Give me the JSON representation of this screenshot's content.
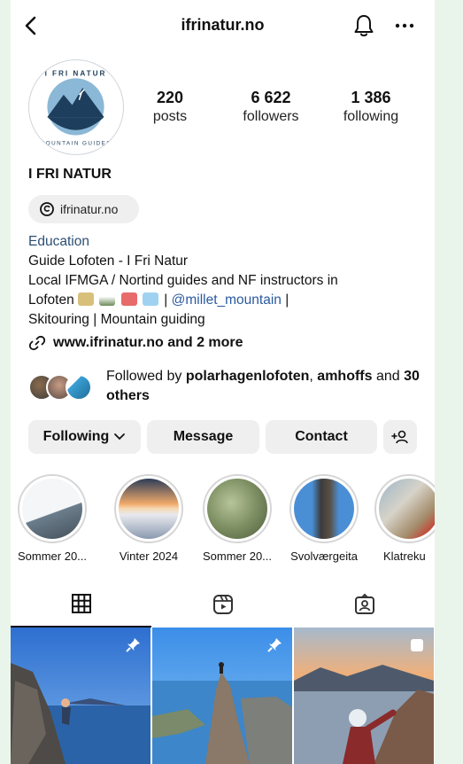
{
  "header": {
    "handle": "ifrinatur.no"
  },
  "icons": {
    "back": "chevron-left-icon",
    "notifications": "bell-icon",
    "more": "more-horizontal-icon"
  },
  "avatar": {
    "logo_text_top": "I FRI NATUR",
    "logo_text_bottom": "MOUNTAIN GUIDES"
  },
  "stats": [
    {
      "value": "220",
      "label": "posts"
    },
    {
      "value": "6 622",
      "label": "followers"
    },
    {
      "value": "1 386",
      "label": "following"
    }
  ],
  "profile": {
    "name": "I FRI NATUR",
    "threads_handle": "ifrinatur.no",
    "category": "Education",
    "bio_line1": "Guide Lofoten - I Fri Natur",
    "bio_line2": "Local IFMGA / Nortind guides and NF instructors in",
    "bio_line3_prefix": "Lofoten",
    "bio_line3_sep": "|",
    "bio_mention": "@millet_mountain",
    "bio_line3_suffix": "|",
    "bio_line4": "Skitouring | Mountain guiding",
    "link": "www.ifrinatur.no and 2 more"
  },
  "followed_by": {
    "prefix": "Followed by",
    "user1": "polarhagenlofoten",
    "comma": ",",
    "user2": "amhoffs",
    "and": "and",
    "others": "30 others"
  },
  "buttons": {
    "following": "Following",
    "message": "Message",
    "contact": "Contact"
  },
  "highlights": [
    {
      "label": "Sommer 20..."
    },
    {
      "label": "Vinter 2024"
    },
    {
      "label": "Sommer 20..."
    },
    {
      "label": "Svolværgeita"
    },
    {
      "label": "Klatreku"
    }
  ],
  "tabs": [
    {
      "name": "posts-grid-icon"
    },
    {
      "name": "reels-icon"
    },
    {
      "name": "tagged-icon"
    }
  ],
  "colors": {
    "accent_link": "#2a5aa0",
    "category": "#2c4f73",
    "button_bg": "#efefef"
  }
}
